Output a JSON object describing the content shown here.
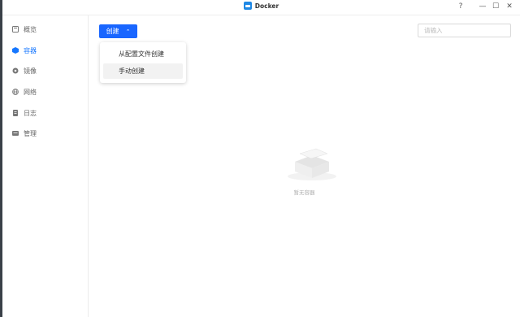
{
  "window": {
    "title": "Docker",
    "help": "?",
    "minimize": "—",
    "maximize": "☐",
    "close": "✕"
  },
  "sidebar": {
    "items": [
      {
        "label": "概览",
        "icon": "overview-icon"
      },
      {
        "label": "容器",
        "icon": "container-icon",
        "active": true
      },
      {
        "label": "镜像",
        "icon": "image-icon"
      },
      {
        "label": "网络",
        "icon": "network-icon"
      },
      {
        "label": "日志",
        "icon": "log-icon"
      },
      {
        "label": "管理",
        "icon": "manage-icon"
      }
    ]
  },
  "toolbar": {
    "create_label": "创建",
    "chevron": "⌃",
    "search_placeholder": "请输入"
  },
  "create_menu": {
    "items": [
      "从配置文件创建",
      "手动创建"
    ]
  },
  "empty_state": {
    "text": "暂无容器"
  },
  "colors": {
    "accent": "#1966ff",
    "active_nav": "#1677ff"
  }
}
